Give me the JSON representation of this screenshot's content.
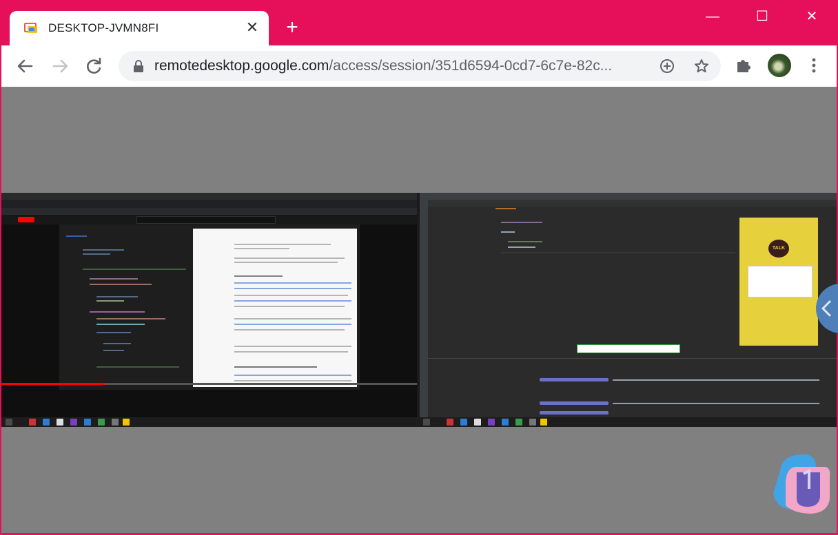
{
  "tab": {
    "title": "DESKTOP-JVMN8FI",
    "close_glyph": "✕",
    "icon": "remote-desktop-icon"
  },
  "new_tab_glyph": "+",
  "window_controls": {
    "minimize": "—",
    "maximize": "☐",
    "close": "✕"
  },
  "toolbar": {
    "url_host": "remotedesktop.google.com",
    "url_path": "/access/session/351d6594-0cd7-6c7e-82c..."
  },
  "remote": {
    "kakao_talk_label": "TALK"
  },
  "colors": {
    "titlebar": "#e60f5a",
    "content_bg": "#808080",
    "omnibox": "#f1f3f4"
  }
}
